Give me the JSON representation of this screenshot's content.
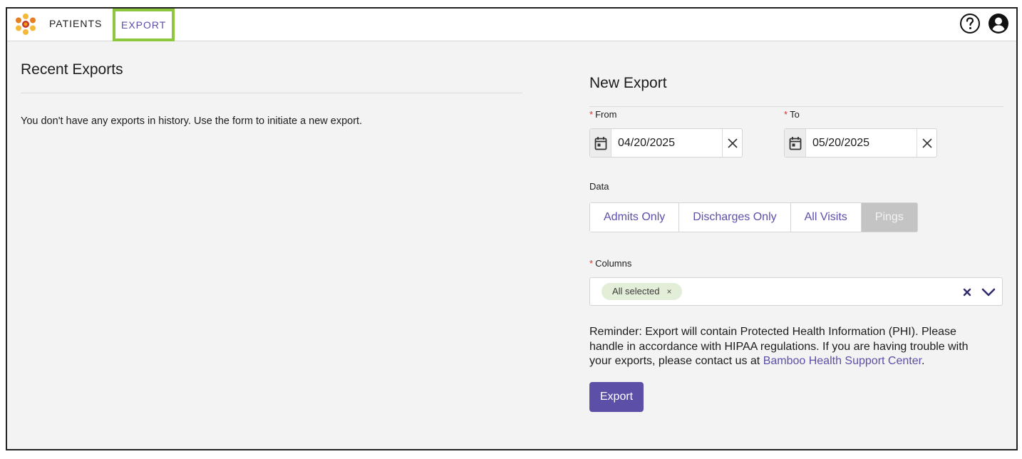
{
  "nav": {
    "logo_icon": "flower-logo-icon",
    "patients_label": "PATIENTS",
    "export_label": "EXPORT",
    "help_icon": "question-circle-icon",
    "user_icon": "user-circle-icon"
  },
  "recent": {
    "title": "Recent Exports",
    "empty_message": "You don't have any exports in history. Use the form to initiate a new export."
  },
  "new_export": {
    "title": "New Export",
    "from": {
      "required_mark": "*",
      "label": "From",
      "value": "04/20/2025"
    },
    "to": {
      "required_mark": "*",
      "label": "To",
      "value": "05/20/2025"
    },
    "data": {
      "label": "Data",
      "options": [
        "Admits Only",
        "Discharges Only",
        "All Visits",
        "Pings"
      ],
      "selected": "Pings"
    },
    "columns": {
      "required_mark": "*",
      "label": "Columns",
      "chip_label": "All selected",
      "chip_remove": "×"
    },
    "reminder": {
      "text": "Reminder: Export will contain Protected Health Information (PHI). Please handle in accordance with HIPAA regulations. If you are having trouble with your exports, please contact us at ",
      "link_text": "Bamboo Health Support Center",
      "end": "."
    },
    "submit_label": "Export"
  },
  "colors": {
    "accent": "#5b4fa8",
    "highlight": "#8dc63f",
    "chip_bg": "#e3eed8",
    "required": "#d0342c"
  }
}
